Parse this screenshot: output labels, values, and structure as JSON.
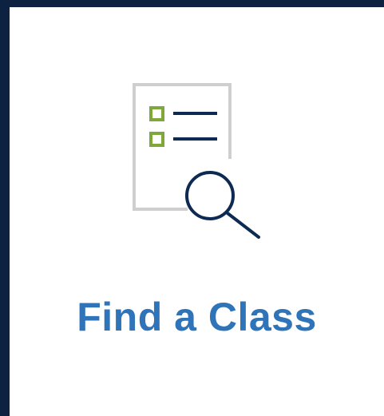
{
  "card": {
    "title": "Find a Class",
    "icon": "document-search-icon"
  },
  "colors": {
    "frame": "#0d2240",
    "card_background": "#ffffff",
    "title": "#2f73b8",
    "checkbox": "#7fa83a",
    "lines": "#0d2a52",
    "document_border": "#cfcfcf",
    "magnifier": "#0d2a52"
  }
}
